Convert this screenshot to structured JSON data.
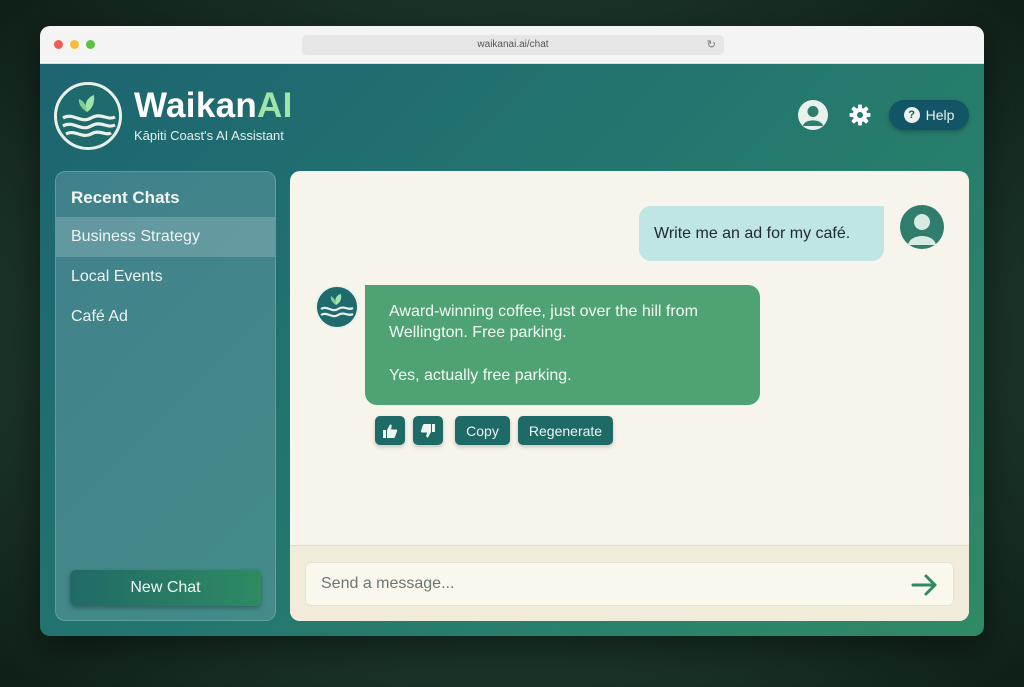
{
  "browser": {
    "url": "waikanai.ai/chat",
    "reload_icon": "↻"
  },
  "header": {
    "brand_main": "Waikan",
    "brand_accent": "AI",
    "subtitle": "Kāpiti Coast's AI Assistant",
    "help_label": "Help",
    "help_icon": "?"
  },
  "sidebar": {
    "title": "Recent Chats",
    "items": [
      {
        "label": "Business Strategy",
        "active": true
      },
      {
        "label": "Local Events",
        "active": false
      },
      {
        "label": "Café Ad",
        "active": false
      }
    ],
    "new_chat_label": "New Chat"
  },
  "chat": {
    "user_message": "Write me an ad for my café.",
    "bot_message": [
      "Award-winning coffee, just over the hill from Wellington. Free parking.",
      "Yes, actually free parking."
    ],
    "actions": {
      "copy_label": "Copy",
      "regenerate_label": "Regenerate"
    },
    "input_placeholder": "Send a message..."
  },
  "colors": {
    "accent": "#2f8a66",
    "brand_ai": "#9fe4a8",
    "user_bubble": "#bfe6e2",
    "bot_bubble": "#4fa274",
    "button_dark": "#1d6a67"
  }
}
